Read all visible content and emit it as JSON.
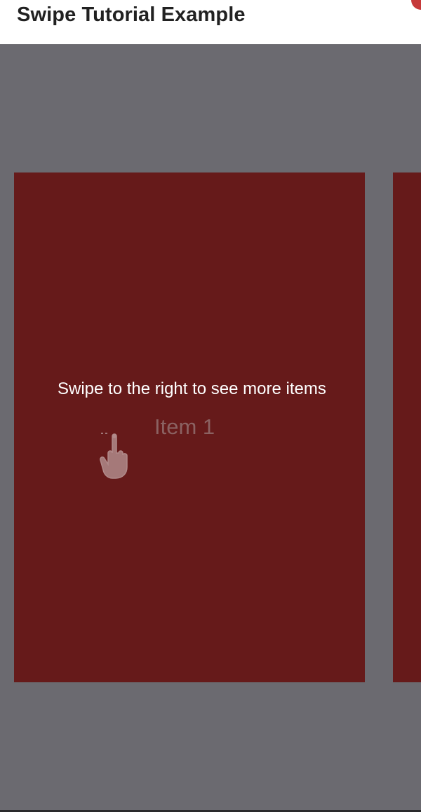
{
  "app_bar": {
    "title": "Swipe Tutorial Example",
    "background": "#ffffff",
    "accent_color": "#c6393a"
  },
  "page": {
    "background": "#6b6a70"
  },
  "carousel": {
    "card_color": "#661a1a",
    "items": [
      {
        "label": "Item 1"
      }
    ]
  },
  "tutorial_overlay": {
    "message": "Swipe to the right to see more items",
    "icon": "swipe-hand-icon"
  }
}
